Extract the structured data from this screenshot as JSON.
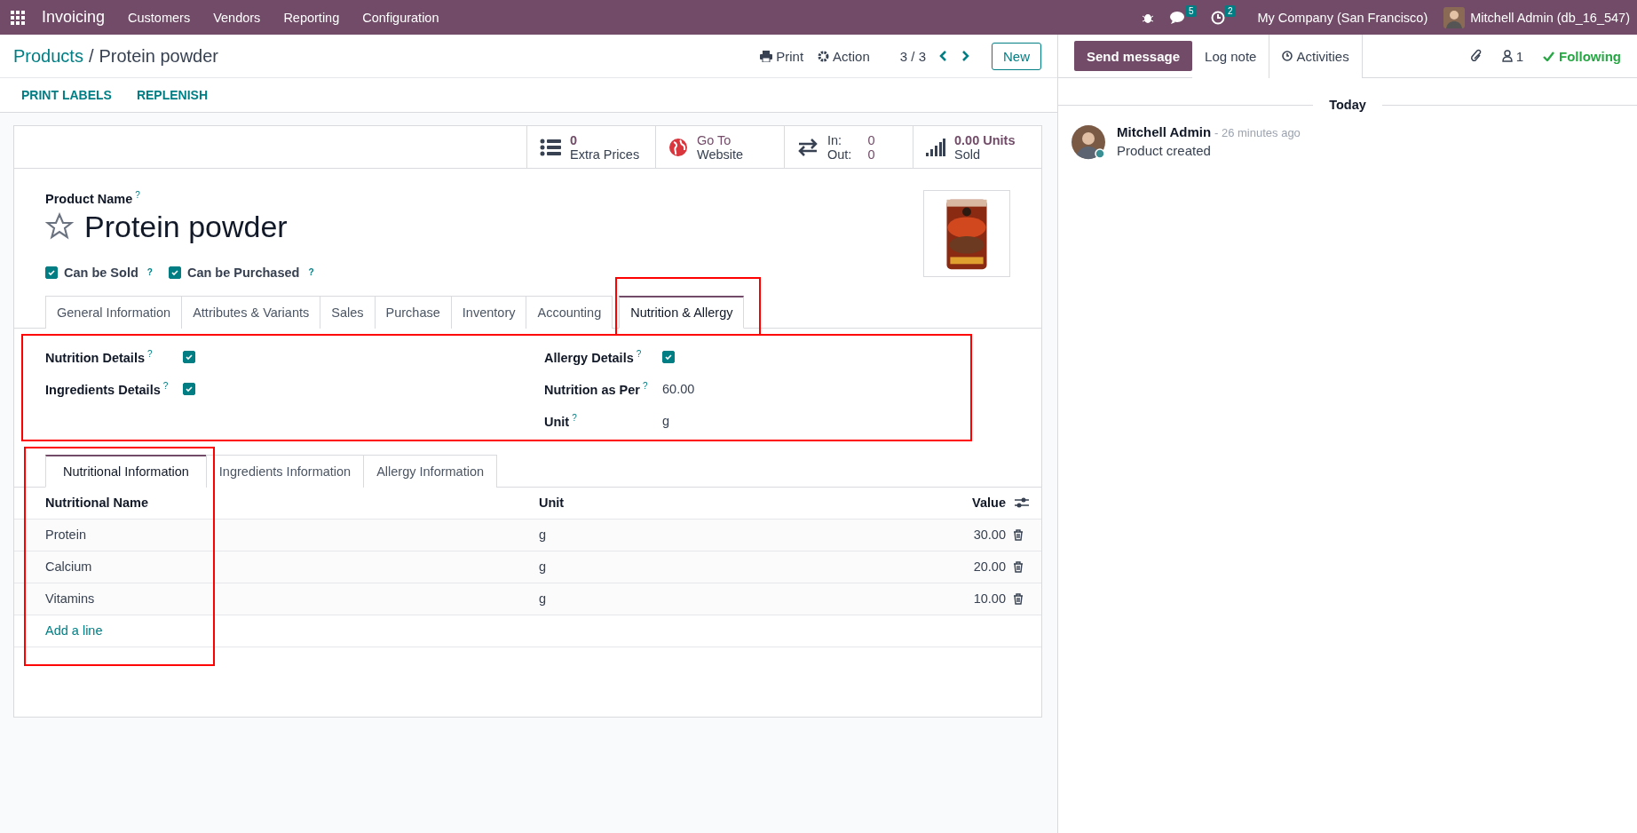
{
  "navbar": {
    "app": "Invoicing",
    "menus": [
      "Customers",
      "Vendors",
      "Reporting",
      "Configuration"
    ],
    "messages_count": "5",
    "activities_count": "2",
    "company": "My Company (San Francisco)",
    "user": "Mitchell Admin (db_16_547)"
  },
  "breadcrumb": {
    "parent": "Products",
    "separator": "/",
    "current": "Protein powder"
  },
  "actions": {
    "print": "Print",
    "action": "Action",
    "pager": "3 / 3",
    "new": "New"
  },
  "header_buttons": [
    "PRINT LABELS",
    "REPLENISH"
  ],
  "smart_buttons": [
    {
      "kind": "list",
      "value": "0",
      "label": "Extra Prices"
    },
    {
      "kind": "globe",
      "value": "Go To",
      "label": "Website"
    },
    {
      "kind": "inout",
      "in_label": "In:",
      "in_value": "0",
      "out_label": "Out:",
      "out_value": "0"
    },
    {
      "kind": "bars",
      "value": "0.00 Units",
      "label": "Sold"
    }
  ],
  "product": {
    "name_label": "Product Name",
    "help": "?",
    "name": "Protein powder",
    "favorite": false,
    "options": [
      {
        "label": "Can be Sold",
        "help": "?",
        "checked": true
      },
      {
        "label": "Can be Purchased",
        "help": "?",
        "checked": true
      }
    ]
  },
  "tabs": [
    {
      "label": "General Information",
      "selected": false
    },
    {
      "label": "Attributes & Variants",
      "selected": false
    },
    {
      "label": "Sales",
      "selected": false
    },
    {
      "label": "Purchase",
      "selected": false
    },
    {
      "label": "Inventory",
      "selected": false
    },
    {
      "label": "Accounting",
      "selected": false
    },
    {
      "label": "Nutrition & Allergy",
      "selected": true
    }
  ],
  "nutrition_fields": {
    "left": [
      {
        "label": "Nutrition Details",
        "help": "?",
        "kind": "checkbox",
        "checked": true
      },
      {
        "label": "Ingredients Details",
        "help": "?",
        "kind": "checkbox",
        "checked": true
      }
    ],
    "right": [
      {
        "label": "Allergy Details",
        "help": "?",
        "kind": "checkbox",
        "checked": true
      },
      {
        "label": "Nutrition as Per",
        "help": "?",
        "kind": "text",
        "value": "60.00"
      },
      {
        "label": "Unit",
        "help": "?",
        "kind": "text",
        "value": "g"
      }
    ]
  },
  "subtabs": [
    {
      "label": "Nutritional Information",
      "selected": true
    },
    {
      "label": "Ingredients Information",
      "selected": false
    },
    {
      "label": "Allergy Information",
      "selected": false
    }
  ],
  "table": {
    "columns": [
      "Nutritional Name",
      "Unit",
      "Value"
    ],
    "rows": [
      {
        "name": "Protein",
        "unit": "g",
        "value": "30.00"
      },
      {
        "name": "Calcium",
        "unit": "g",
        "value": "20.00"
      },
      {
        "name": "Vitamins",
        "unit": "g",
        "value": "10.00"
      }
    ],
    "add_line": "Add a line"
  },
  "chatter": {
    "buttons": [
      {
        "label": "Send message",
        "selected": true
      },
      {
        "label": "Log note",
        "selected": false
      },
      {
        "label": "Activities",
        "selected": false
      }
    ],
    "followers_count": "1",
    "following": "Following",
    "date_separator": "Today",
    "messages": [
      {
        "author": "Mitchell Admin",
        "time": "- 26 minutes ago",
        "body": "Product created"
      }
    ]
  }
}
